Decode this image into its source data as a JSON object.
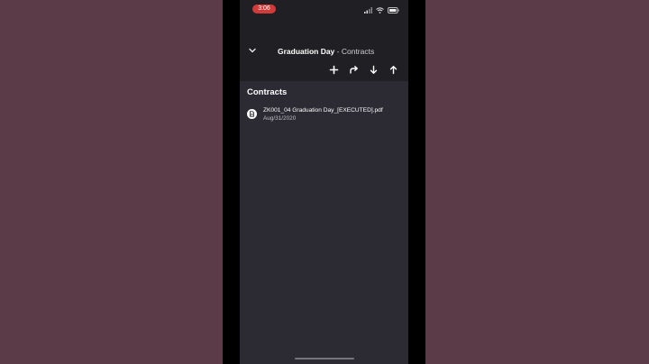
{
  "status_bar": {
    "time": "3:06"
  },
  "header": {
    "title_bold": "Graduation Day",
    "title_rest": " - Contracts"
  },
  "icons": {
    "back": "chevron-down-icon",
    "add": "plus-icon",
    "share": "share-icon",
    "download": "arrow-down-icon",
    "upload": "arrow-up-icon",
    "file": "document-icon"
  },
  "section": {
    "title": "Contracts"
  },
  "files": [
    {
      "name": "ZK001_04 Graduation Day_[EXECUTED].pdf",
      "date": "Aug/31/2020"
    }
  ],
  "colors": {
    "background": "#5b3b47",
    "app_bg": "#2c2a33",
    "header_bg": "#201f23",
    "time_pill": "#d23a3a"
  }
}
